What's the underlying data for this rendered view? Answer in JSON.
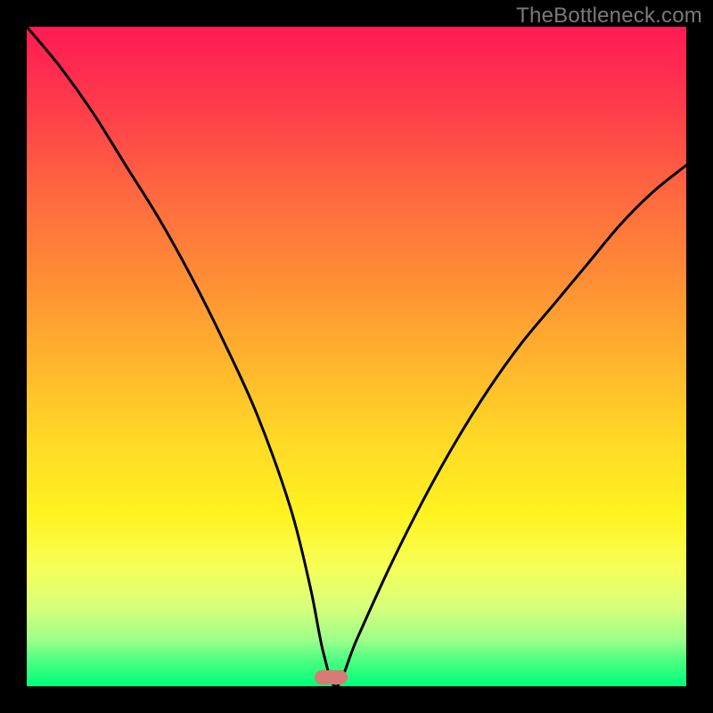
{
  "watermark": "TheBottleneck.com",
  "marker": {
    "x_frac": 0.462,
    "y_frac": 0.986,
    "w_frac": 0.05,
    "h_frac": 0.022,
    "color": "#d97b75"
  },
  "chart_data": {
    "type": "line",
    "title": "",
    "xlabel": "",
    "ylabel": "",
    "xlim": [
      0,
      100
    ],
    "ylim": [
      0,
      100
    ],
    "background_gradient": {
      "top": "#ff1a54",
      "mid": "#ffe028",
      "bottom": "#00ff7a"
    },
    "series": [
      {
        "name": "bottleneck-curve",
        "x": [
          0,
          5,
          10,
          15,
          20,
          25,
          30,
          35,
          40,
          43,
          45,
          47,
          50,
          55,
          60,
          65,
          70,
          75,
          80,
          85,
          90,
          95,
          100
        ],
        "values": [
          100,
          94,
          87,
          79,
          71,
          62,
          52,
          41,
          27,
          15,
          5,
          0,
          7,
          18,
          28,
          37,
          45,
          52,
          58,
          64,
          70,
          75,
          79
        ]
      }
    ],
    "minimum_point": {
      "x": 47,
      "y": 0
    },
    "annotations": []
  }
}
